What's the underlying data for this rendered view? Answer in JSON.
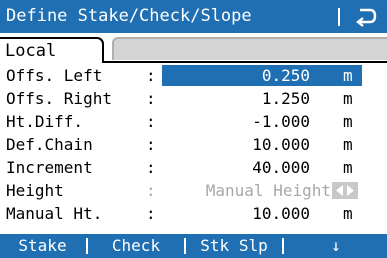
{
  "window": {
    "title": "Define Stake/Check/Slope"
  },
  "tabs": [
    {
      "label": "Local"
    }
  ],
  "fields": [
    {
      "label": "Offs. Left",
      "value": "0.250",
      "unit": "m"
    },
    {
      "label": "Offs. Right",
      "value": "1.250",
      "unit": "m"
    },
    {
      "label": "Ht.Diff.",
      "value": "-1.000",
      "unit": "m"
    },
    {
      "label": "Def.Chain",
      "value": "10.000",
      "unit": "m"
    },
    {
      "label": "Increment",
      "value": "40.000",
      "unit": "m"
    },
    {
      "label": "Height",
      "value": "Manual Height"
    },
    {
      "label": "Manual Ht.",
      "value": "10.000",
      "unit": "m"
    }
  ],
  "softkeys": [
    "Stake",
    "Check",
    "Stk Slp",
    "↓"
  ],
  "colors": {
    "accent": "#1f6fb2",
    "disabled": "#a8a8a8"
  }
}
